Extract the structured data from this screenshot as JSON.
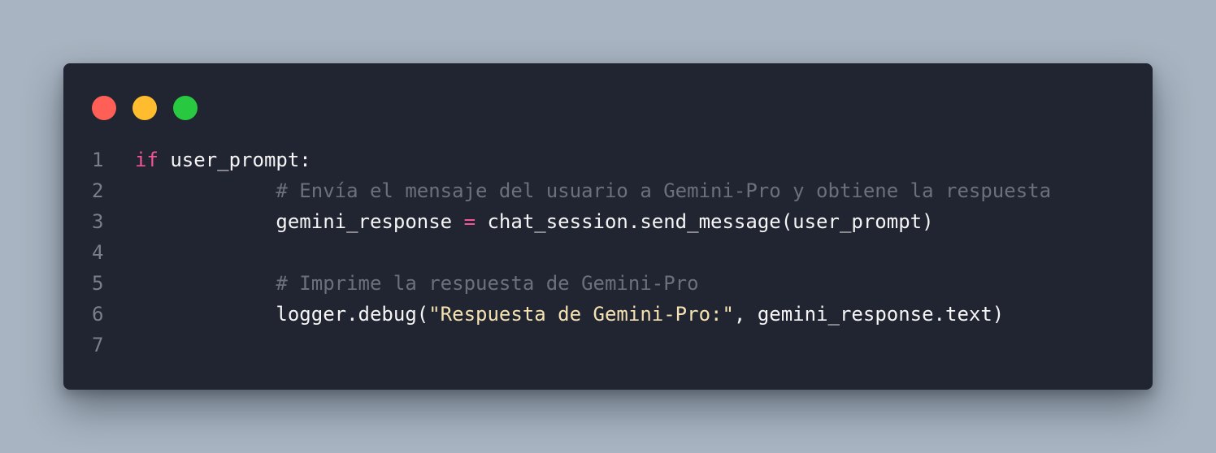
{
  "window": {
    "controls": [
      {
        "name": "close",
        "color": "#ff5f57"
      },
      {
        "name": "minimize",
        "color": "#febc2e"
      },
      {
        "name": "maximize",
        "color": "#28c840"
      }
    ]
  },
  "colors": {
    "background": "#a8b4c1",
    "editor": "#212431",
    "keyword": "#f2559a",
    "comment": "#6c707c",
    "string": "#f4e2b0",
    "text": "#f5f5f5",
    "line_number": "#7b7f8c"
  },
  "code": {
    "language": "python",
    "lines": [
      {
        "number": "1",
        "tokens": [
          {
            "type": "kw",
            "text": "if"
          },
          {
            "type": "pl",
            "text": " user_prompt:"
          }
        ]
      },
      {
        "number": "2",
        "tokens": [
          {
            "type": "cm",
            "text": "            # Envía el mensaje del usuario a Gemini-Pro y obtiene la respuesta"
          }
        ]
      },
      {
        "number": "3",
        "tokens": [
          {
            "type": "pl",
            "text": "            gemini_response "
          },
          {
            "type": "op",
            "text": "="
          },
          {
            "type": "pl",
            "text": " chat_session.send_message(user_prompt)"
          }
        ]
      },
      {
        "number": "4",
        "tokens": []
      },
      {
        "number": "5",
        "tokens": [
          {
            "type": "cm",
            "text": "            # Imprime la respuesta de Gemini-Pro"
          }
        ]
      },
      {
        "number": "6",
        "tokens": [
          {
            "type": "pl",
            "text": "            logger.debug("
          },
          {
            "type": "str",
            "text": "\"Respuesta de Gemini-Pro:\""
          },
          {
            "type": "pl",
            "text": ", gemini_response.text)"
          }
        ]
      },
      {
        "number": "7",
        "tokens": []
      }
    ]
  }
}
